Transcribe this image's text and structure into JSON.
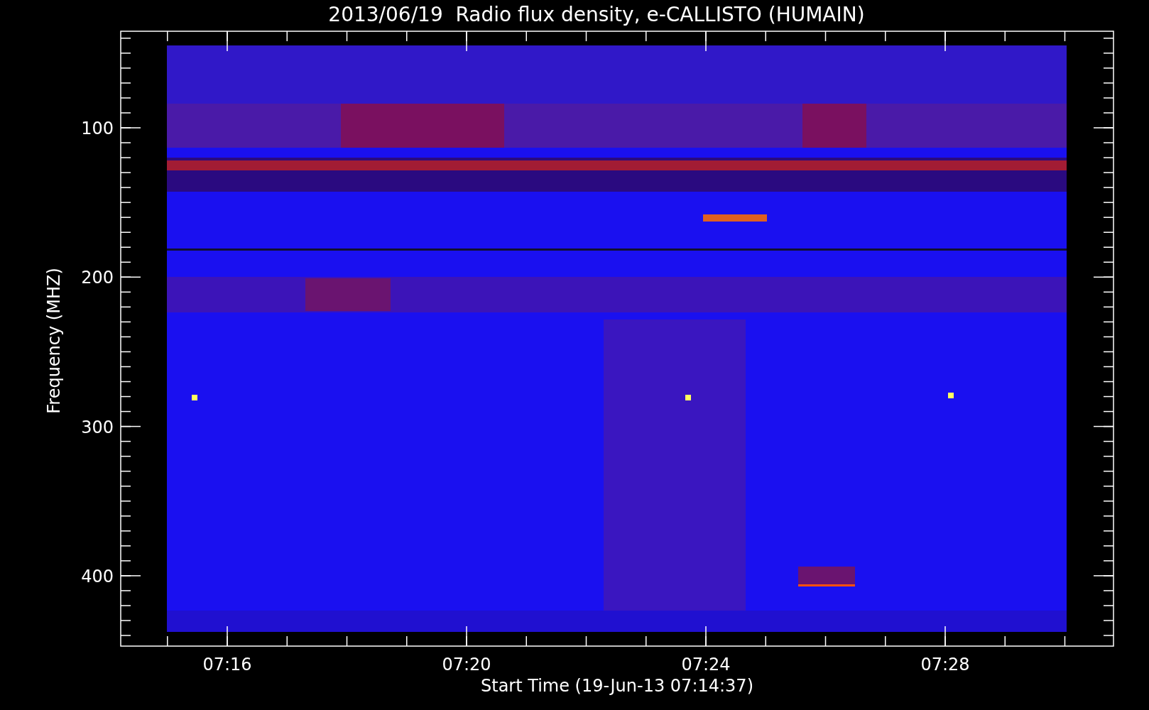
{
  "plot": {
    "title": "2013/06/19  Radio flux density, e-CALLISTO (HUMAIN)",
    "ylabel": "Frequency (MHZ)",
    "xlabel": "Start Time (19-Jun-13 07:14:37)",
    "yticks": [
      "100",
      "200",
      "300",
      "400"
    ],
    "xticks": [
      "07:16",
      "07:20",
      "07:24",
      "07:28"
    ]
  }
}
